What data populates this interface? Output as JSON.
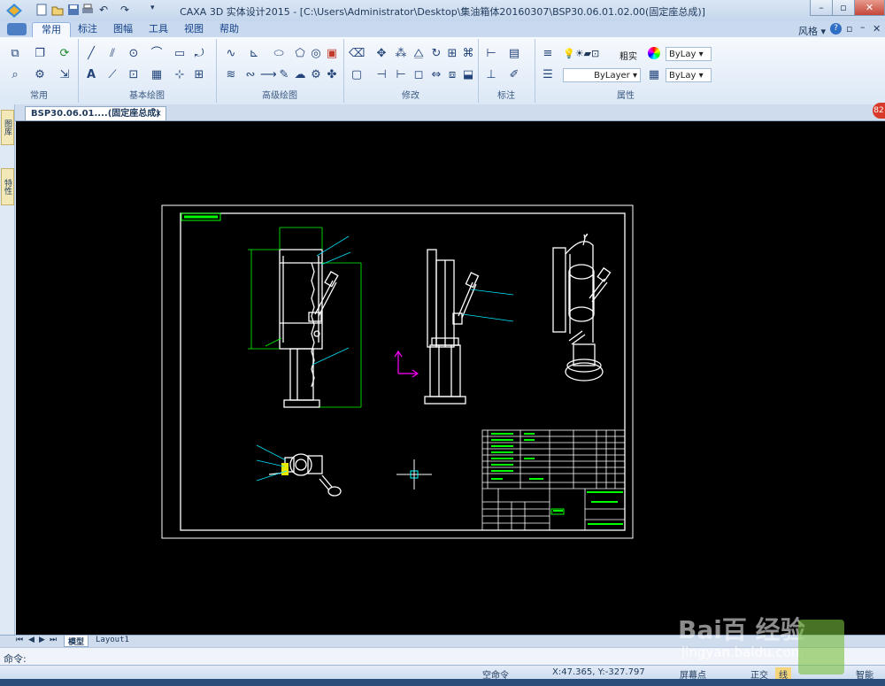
{
  "title": "CAXA 3D 实体设计2015 - [C:\\Users\\Administrator\\Desktop\\集油箱体20160307\\BSP30.06.01.02.00(固定座总成)]",
  "ribbon_tabs": [
    "常用",
    "标注",
    "图幅",
    "工具",
    "视图",
    "帮助"
  ],
  "active_tab": "常用",
  "style_label": "风格",
  "groups": {
    "common": "常用",
    "basic_draw": "基本绘图",
    "advanced_draw": "高级绘图",
    "modify": "修改",
    "annotate": "标注",
    "properties": "属性"
  },
  "properties": {
    "linetype_label": "粗实",
    "layer1": "ByLay",
    "layer2": "ByLayer",
    "layer3": "ByLay"
  },
  "doc_tab": "BSP30.06.01....(固定座总成)",
  "side_tabs": [
    "图库",
    "特性"
  ],
  "notification_badge": "82",
  "layout_tabs": [
    "模型",
    "Layout1"
  ],
  "command_prompt": "命令:",
  "status": {
    "idle": "空命令",
    "coords": "X:47.365, Y:-327.797",
    "snap": "屏幕点",
    "ortho": "正交",
    "lineweight": "线",
    "smart": "智能"
  },
  "watermark": {
    "brand": "Bai百 经验",
    "url": "jingyan.baidu.com"
  },
  "colors": {
    "canvas": "#000000",
    "drawing": "#ffffff",
    "annotation": "#00ff00",
    "leader": "#00e5ff",
    "axis": "#ff00ff"
  }
}
